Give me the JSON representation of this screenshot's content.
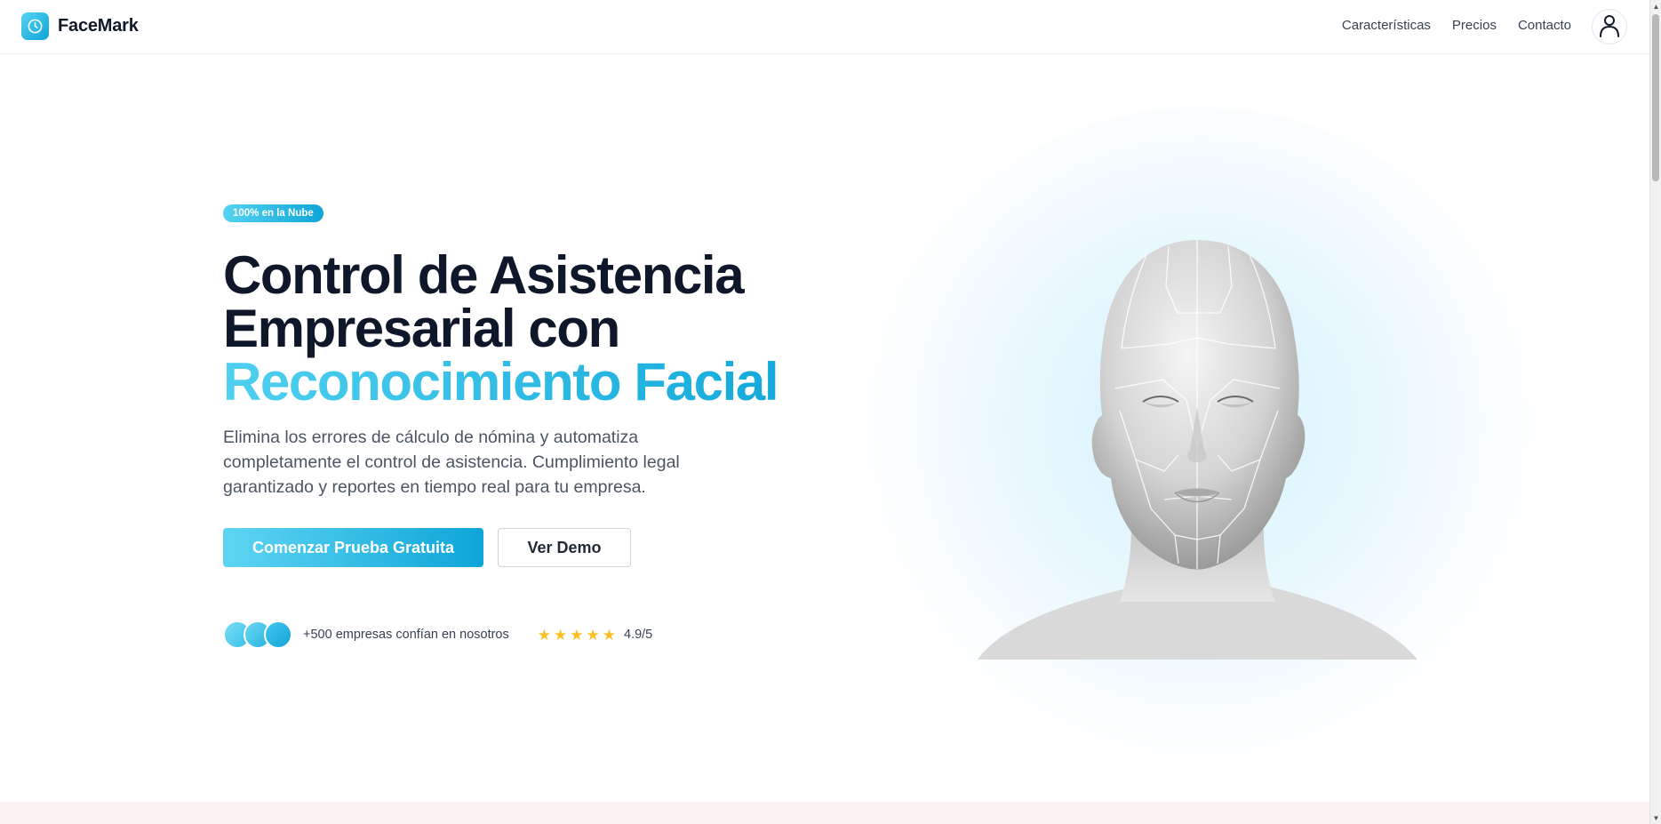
{
  "brand": {
    "name": "FaceMark",
    "logo_icon": "clock-icon"
  },
  "nav": {
    "items": [
      "Características",
      "Precios",
      "Contacto"
    ],
    "account_icon": "user-icon"
  },
  "hero": {
    "badge": "100% en la Nube",
    "title_line1": "Control de Asistencia",
    "title_line2": "Empresarial con",
    "title_accent": "Reconocimiento Facial",
    "subtitle": "Elimina los errores de cálculo de nómina y automatiza completamente el control de asistencia. Cumplimiento legal garantizado y reportes en tiempo real para tu empresa.",
    "primary_cta": "Comenzar Prueba Gratuita",
    "secondary_cta": "Ver Demo",
    "social_proof": "+500 empresas confían en nosotros",
    "stars": 5,
    "rating": "4.9/5"
  },
  "colors": {
    "accent_start": "#5fd5f3",
    "accent_end": "#0ea5d8",
    "star": "#fbbf24",
    "title": "#0f172a"
  }
}
